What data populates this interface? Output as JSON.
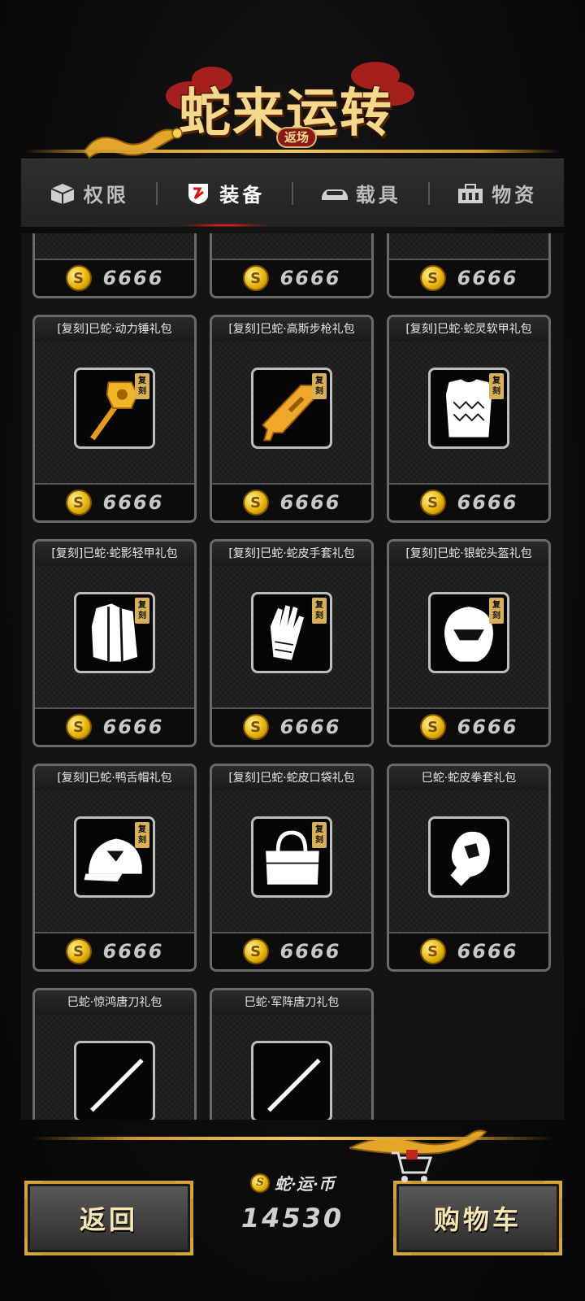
{
  "header": {
    "title": "蛇来运转",
    "subtitle": "返场"
  },
  "tabs": [
    {
      "label": "权限",
      "icon": "box-icon"
    },
    {
      "label": "装备",
      "icon": "shield-icon",
      "active": true
    },
    {
      "label": "载具",
      "icon": "car-icon"
    },
    {
      "label": "物资",
      "icon": "toolbox-icon"
    }
  ],
  "items": [
    {
      "title": "",
      "icon": "sniper-rifle-icon",
      "price": "6666",
      "replica": false
    },
    {
      "title": "",
      "icon": "serpent-sword-icon",
      "price": "6666",
      "replica": false
    },
    {
      "title": "",
      "icon": "katana-icon",
      "price": "6666",
      "replica": false
    },
    {
      "title": "[复刻]巳蛇·动力锤礼包",
      "icon": "power-hammer-icon",
      "price": "6666",
      "replica": true
    },
    {
      "title": "[复刻]巳蛇·高斯步枪礼包",
      "icon": "gauss-rifle-icon",
      "price": "6666",
      "replica": true
    },
    {
      "title": "[复刻]巳蛇·蛇灵软甲礼包",
      "icon": "soft-armor-icon",
      "price": "6666",
      "replica": true
    },
    {
      "title": "[复刻]巳蛇·蛇影轻甲礼包",
      "icon": "light-armor-icon",
      "price": "6666",
      "replica": true
    },
    {
      "title": "[复刻]巳蛇·蛇皮手套礼包",
      "icon": "gloves-icon",
      "price": "6666",
      "replica": true
    },
    {
      "title": "[复刻]巳蛇·银蛇头盔礼包",
      "icon": "helmet-icon",
      "price": "6666",
      "replica": true
    },
    {
      "title": "[复刻]巳蛇·鸭舌帽礼包",
      "icon": "cap-icon",
      "price": "6666",
      "replica": true
    },
    {
      "title": "[复刻]巳蛇·蛇皮口袋礼包",
      "icon": "bag-icon",
      "price": "6666",
      "replica": true
    },
    {
      "title": "巳蛇·蛇皮拳套礼包",
      "icon": "boxing-glove-icon",
      "price": "6666",
      "replica": false
    },
    {
      "title": "巳蛇·惊鸿唐刀礼包",
      "icon": "tang-sword-icon",
      "price": "",
      "replica": false
    },
    {
      "title": "巳蛇·军阵唐刀礼包",
      "icon": "tang-sword-icon",
      "price": "",
      "replica": false
    }
  ],
  "replica_badge": "复刻",
  "footer": {
    "back_label": "返回",
    "cart_label": "购物车",
    "currency_label": "蛇·运·币",
    "currency_value": "14530"
  },
  "colors": {
    "gold": "#f1c760",
    "active_tab_glow": "#ff2a2a",
    "card_border": "#6a6a6a",
    "button_border": "#c99a30"
  }
}
